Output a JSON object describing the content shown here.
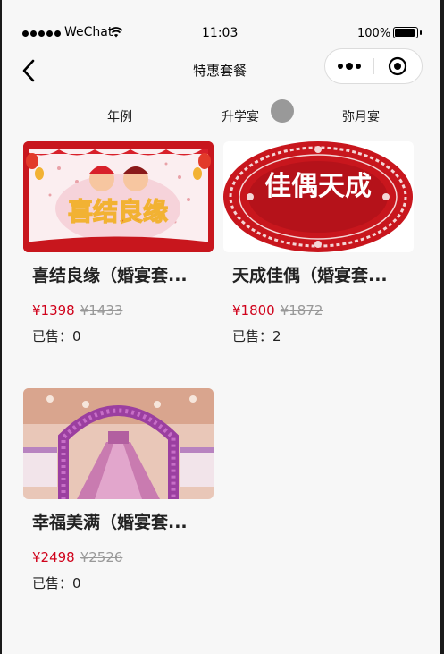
{
  "status_bar": {
    "carrier": "WeChat",
    "time": "11:03",
    "battery": "100%"
  },
  "nav": {
    "title": "特惠套餐"
  },
  "tabs": [
    {
      "label": "年例"
    },
    {
      "label": "升学宴"
    },
    {
      "label": "弥月宴"
    }
  ],
  "products": [
    {
      "name": "喜结良缘（婚宴套...",
      "price": "¥1398",
      "original_price": "¥1433",
      "sold_label": "已售：",
      "sold": "0",
      "image_text": "喜结良缘"
    },
    {
      "name": "天成佳偶（婚宴套...",
      "price": "¥1800",
      "original_price": "¥1872",
      "sold_label": "已售：",
      "sold": "2",
      "image_text": "佳偶天成"
    },
    {
      "name": "幸福美满（婚宴套...",
      "price": "¥2498",
      "original_price": "¥2526",
      "sold_label": "已售：",
      "sold": "0"
    }
  ]
}
